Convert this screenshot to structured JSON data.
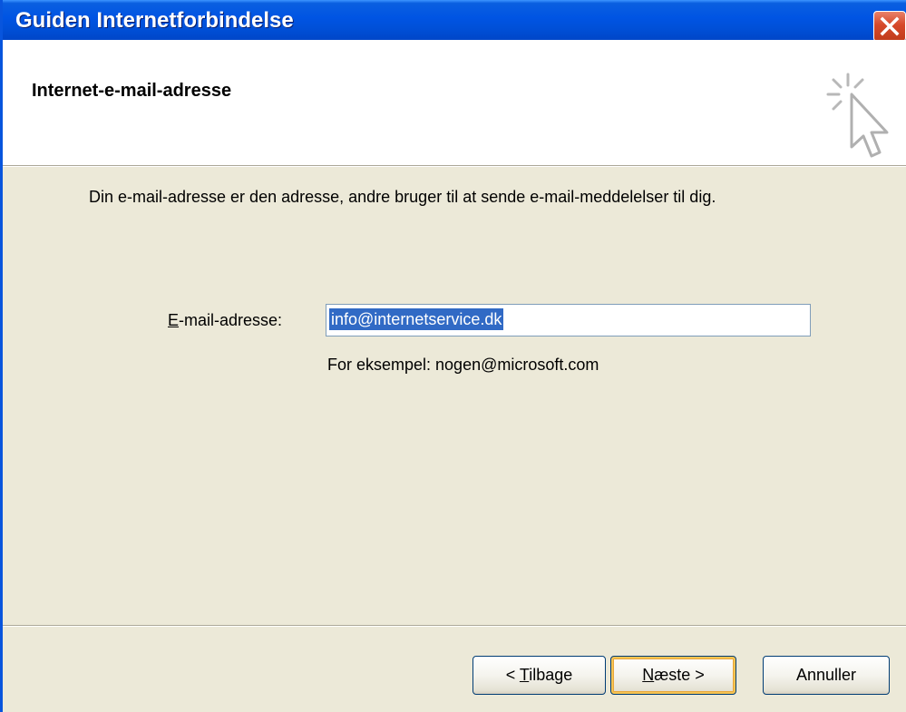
{
  "window": {
    "title": "Guiden Internetforbindelse"
  },
  "header": {
    "heading": "Internet-e-mail-adresse"
  },
  "body": {
    "description": "Din e-mail-adresse er den adresse, andre bruger til at sende e-mail-meddelelser til dig.",
    "email_label_mnemonic": "E",
    "email_label_rest": "-mail-adresse:",
    "email_value": "info@internetservice.dk",
    "example": "For eksempel: nogen@microsoft.com"
  },
  "buttons": {
    "back_prefix": "< ",
    "back_mnemonic": "T",
    "back_rest": "ilbage",
    "next_mnemonic": "N",
    "next_rest": "æste >",
    "cancel": "Annuller"
  },
  "icons": {
    "close": "close-icon",
    "wizard": "cursor-sparkle-icon"
  },
  "colors": {
    "titlebar": "#0054e3",
    "selection": "#316ac5",
    "dialog_bg": "#ece9d8",
    "close_button": "#d6492a"
  }
}
